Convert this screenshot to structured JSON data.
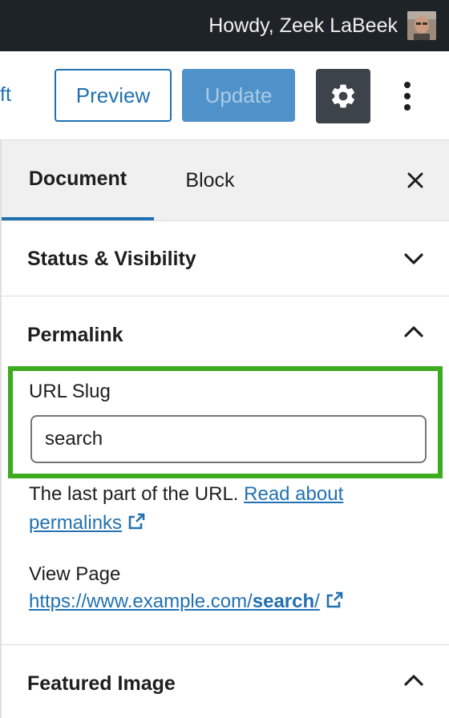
{
  "admin_bar": {
    "greeting": "Howdy, Zeek LaBeek"
  },
  "header": {
    "cutoff_text": "ft",
    "preview_label": "Preview",
    "update_label": "Update",
    "settings_icon": "gear-icon",
    "more_icon": "vertical-ellipsis-icon"
  },
  "sidebar": {
    "tabs": [
      {
        "label": "Document",
        "active": true
      },
      {
        "label": "Block",
        "active": false
      }
    ],
    "close_icon": "close-icon",
    "status_visibility": {
      "title": "Status & Visibility",
      "expanded": false
    },
    "permalink": {
      "title": "Permalink",
      "expanded": true,
      "url_slug_label": "URL Slug",
      "url_slug_value": "search",
      "help_text": "The last part of the URL.",
      "help_link": "Read about permalinks",
      "view_page_label": "View Page",
      "view_page_url_prefix": "https://www.example.com/",
      "view_page_url_slug": "search",
      "view_page_url_suffix": "/"
    },
    "featured_image": {
      "title": "Featured Image",
      "expanded": true
    }
  },
  "colors": {
    "admin_bar_bg": "#1d2327",
    "accent": "#2271b1",
    "highlight_border": "#3cab1e",
    "settings_button_bg": "#3c434a"
  }
}
